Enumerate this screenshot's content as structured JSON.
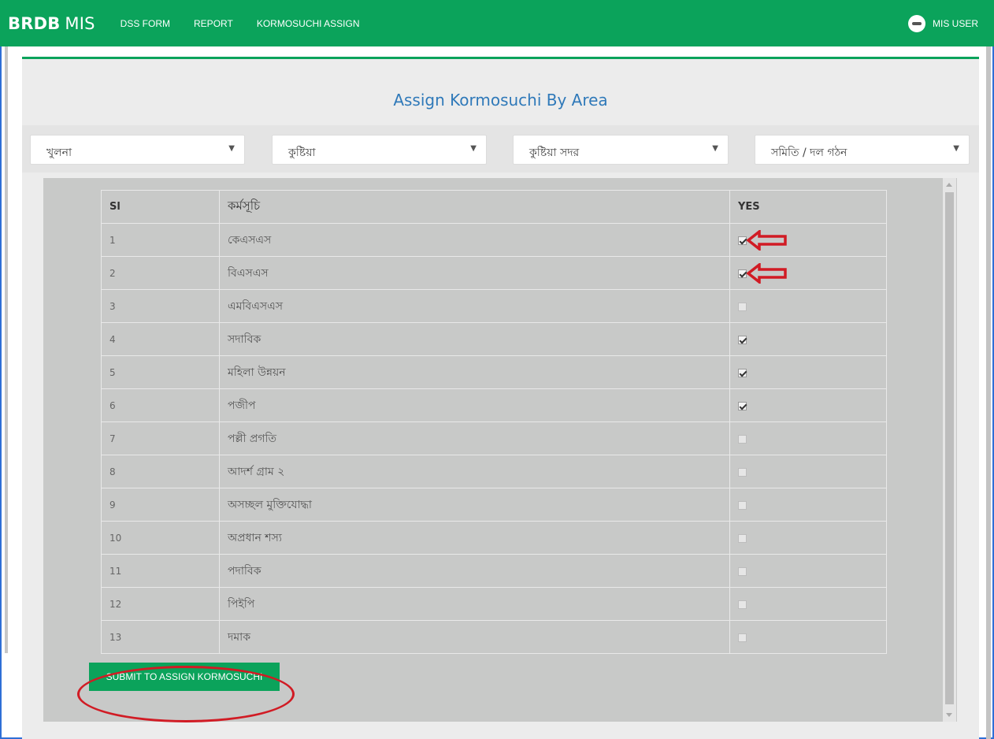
{
  "navbar": {
    "brand_bold": "BRDB",
    "brand_light": "MIS",
    "links": [
      "DSS FORM",
      "REPORT",
      "KORMOSUCHI ASSIGN"
    ],
    "user_name": "MIS USER"
  },
  "page": {
    "title": "Assign Kormosuchi By Area"
  },
  "filters": {
    "division": "খুলনা",
    "district": "কুষ্টিয়া",
    "upazila": "কুষ্টিয়া সদর",
    "type": "সমিতি / দল গঠন"
  },
  "table": {
    "headers": [
      "Sl",
      "কর্মসূচি",
      "YES"
    ],
    "rows": [
      {
        "sl": "1",
        "name": "কেএসএস",
        "yes": true
      },
      {
        "sl": "2",
        "name": "বিএসএস",
        "yes": true
      },
      {
        "sl": "3",
        "name": "এমবিএসএস",
        "yes": false
      },
      {
        "sl": "4",
        "name": "সদাবিক",
        "yes": true
      },
      {
        "sl": "5",
        "name": "মহিলা উন্নয়ন",
        "yes": true
      },
      {
        "sl": "6",
        "name": "পজীপ",
        "yes": true
      },
      {
        "sl": "7",
        "name": "পল্লী প্রগতি",
        "yes": false
      },
      {
        "sl": "8",
        "name": "আদর্শ গ্রাম ২",
        "yes": false
      },
      {
        "sl": "9",
        "name": "অসচ্ছল মুক্তিযোদ্ধা",
        "yes": false
      },
      {
        "sl": "10",
        "name": "অপ্রধান শস্য",
        "yes": false
      },
      {
        "sl": "11",
        "name": "পদাবিক",
        "yes": false
      },
      {
        "sl": "12",
        "name": "পিইপি",
        "yes": false
      },
      {
        "sl": "13",
        "name": "দমাক",
        "yes": false
      }
    ]
  },
  "actions": {
    "submit_label": "SUBMIT TO ASSIGN KORMOSUCHI"
  },
  "colors": {
    "brand_green": "#0ba35b",
    "title_blue": "#2f79b9",
    "annotation_red": "#d11b24"
  }
}
